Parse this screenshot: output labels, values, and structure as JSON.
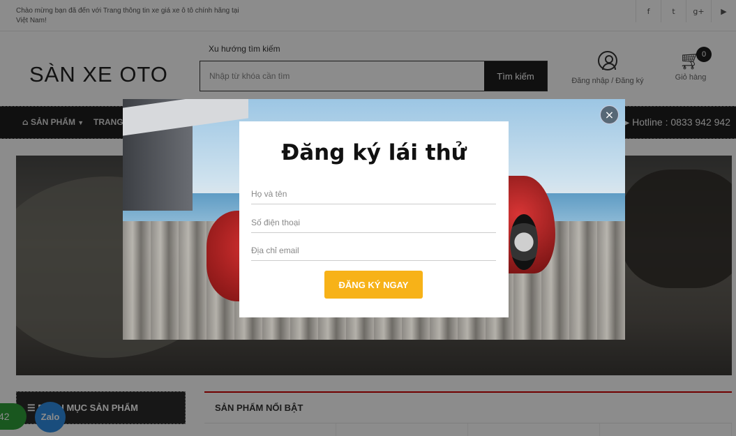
{
  "topbar": {
    "welcome": "Chào mừng bạn đã đến với Trang thông tin xe giá xe ô tô chính hãng tại Việt Nam!",
    "social": [
      {
        "icon": "facebook-icon",
        "glyph": "f"
      },
      {
        "icon": "twitter-icon",
        "glyph": "t"
      },
      {
        "icon": "google-plus-icon",
        "glyph": "g+"
      },
      {
        "icon": "youtube-icon",
        "glyph": "▶"
      }
    ]
  },
  "header": {
    "logo": "SÀN XE OTO",
    "trend_label": "Xu hướng tìm kiếm",
    "search_placeholder": "Nhập từ khóa cần tìm",
    "search_button": "Tìm kiếm",
    "login_label": "Đăng nhập / Đăng ký",
    "cart_label": "Giỏ hàng",
    "cart_count": "0"
  },
  "nav": {
    "products": "SẢN PHẨM",
    "home": "TRANG",
    "hotline": "Hotline : 0833 942 942"
  },
  "sidebar": {
    "category_title": "DANH MỤC SẢN PHẨM"
  },
  "featured": {
    "title": "SẢN PHẨM NỔI BẬT"
  },
  "floating": {
    "phone": "42",
    "zalo": "Zalo"
  },
  "modal": {
    "title": "Đăng ký lái thử",
    "name_placeholder": "Họ và tên",
    "phone_placeholder": "Số điện thoại",
    "email_placeholder": "Địa chỉ email",
    "submit": "ĐĂNG KÝ NGAY",
    "close": "×"
  }
}
